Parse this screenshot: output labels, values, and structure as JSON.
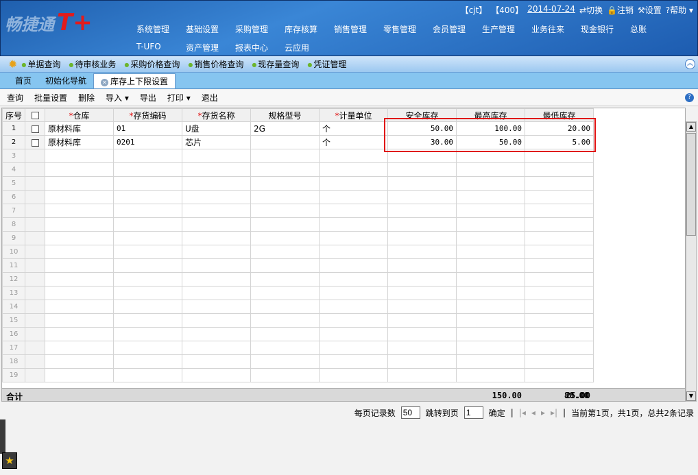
{
  "header": {
    "logo": "畅捷通",
    "logo_mark": "T+",
    "user": "【cjt】",
    "account": "【400】",
    "date": "2014-07-24",
    "switch": "切换",
    "logout": "注销",
    "settings": "设置",
    "help": "帮助",
    "menu_row1": [
      "系统管理",
      "基础设置",
      "采购管理",
      "库存核算",
      "销售管理",
      "零售管理",
      "会员管理",
      "生产管理",
      "业务往来",
      "现金银行",
      "总账"
    ],
    "menu_row2": [
      "T-UFO",
      "资产管理",
      "报表中心",
      "云应用"
    ]
  },
  "shortcuts": [
    "单据查询",
    "待审核业务",
    "采购价格查询",
    "销售价格查询",
    "现存量查询",
    "凭证管理"
  ],
  "tabs": [
    "首页",
    "初始化导航",
    "库存上下限设置"
  ],
  "toolbar": [
    "查询",
    "批量设置",
    "删除",
    "导入 ▾",
    "导出",
    "打印 ▾",
    "退出"
  ],
  "grid": {
    "columns": [
      "序号",
      "",
      "仓库",
      "存货编码",
      "存货名称",
      "规格型号",
      "计量单位",
      "安全库存",
      "最高库存",
      "最低库存"
    ],
    "rows": [
      [
        "1",
        "",
        "原材料库",
        "01",
        "U盘",
        "2G",
        "个",
        "50.00",
        "100.00",
        "20.00"
      ],
      [
        "2",
        "",
        "原材料库",
        "0201",
        "芯片",
        "",
        "个",
        "30.00",
        "50.00",
        "5.00"
      ]
    ],
    "empty_row_numbers": [
      "3",
      "4",
      "5",
      "6",
      "7",
      "8",
      "9",
      "10",
      "11",
      "12",
      "13",
      "14",
      "15",
      "16",
      "17",
      "18",
      "19"
    ],
    "total_label": "合计",
    "totals": [
      "80.00",
      "150.00",
      "25.00"
    ]
  },
  "pager": {
    "page_size_label": "每页记录数",
    "page_size": "50",
    "jump_label": "跳转到页",
    "jump_page": "1",
    "confirm": "确定",
    "status": "当前第1页，共1页，总共2条记录"
  }
}
